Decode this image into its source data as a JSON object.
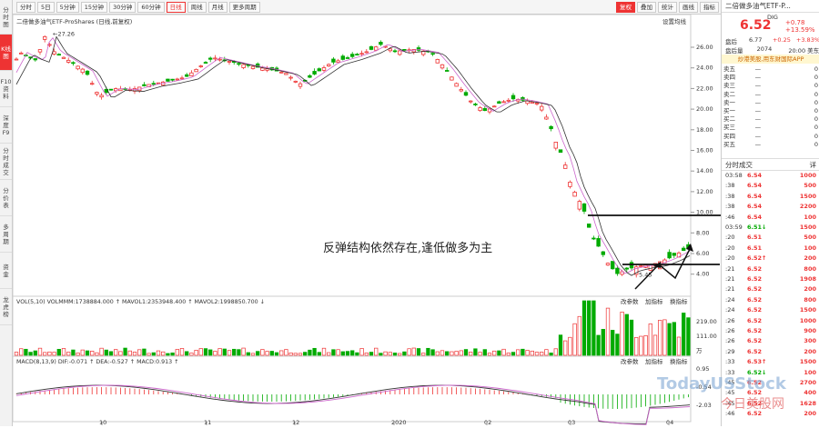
{
  "sidebar": [
    "分时图",
    "K线图",
    "F10资料",
    "深度F9",
    "分时成交",
    "分价表",
    "多周期",
    "资金",
    "龙虎榜"
  ],
  "toolbar": {
    "items": [
      "分时",
      "5日",
      "5分钟",
      "15分钟",
      "30分钟",
      "60分钟",
      "日线",
      "周线",
      "月线",
      "更多周期"
    ],
    "active": "日线",
    "right": [
      "复权",
      "叠加",
      "统计",
      "画线",
      "指标"
    ]
  },
  "chart": {
    "title": "二倍做多油气ETF-ProShares (日线,前复权)",
    "settings": "设置均线",
    "high_label": "27.26",
    "low_label": "5.45",
    "price_ticks": [
      "26.00",
      "24.00",
      "22.00",
      "20.00",
      "18.00",
      "16.00",
      "14.00",
      "12.00",
      "10.00",
      "8.00",
      "6.00",
      "4.00"
    ],
    "vol_legend": "VOL(5,10) VOLMMM:1738884.000 ↑ MAVOL1:2353948.400 ↑ MAVOL2:1998850.700 ↓",
    "vol_ticks": [
      "219.00",
      "111.00",
      "万"
    ],
    "macd_legend": "MACD(8,13,9) DIF:-0.071 ↑ DEA:-0.527 ↑ MACD:0.913 ↑",
    "macd_ticks": [
      "0.95",
      "-0.54",
      "-2.03"
    ],
    "sub_buttons": [
      "改参数",
      "加指标",
      "换指标"
    ],
    "dates": [
      "10",
      "11",
      "12",
      "2020",
      "02",
      "03",
      "04"
    ],
    "annotation": "反弹结构依然存在,逢低做多为主"
  },
  "quote": {
    "name": "二倍做多油气ETF-P...",
    "code": "DIG",
    "price": "6.52",
    "change": "+0.78",
    "pct": "+13.59%",
    "row1": [
      "盘后",
      "6.77",
      "+0.25",
      "+3.83%"
    ],
    "row2": [
      "盘后量",
      "2074",
      "20:00 美东"
    ],
    "banner": "炒港美股,用东财国际APP",
    "asks": [
      [
        "卖五",
        "—",
        "0"
      ],
      [
        "卖四",
        "—",
        "0"
      ],
      [
        "卖三",
        "—",
        "0"
      ],
      [
        "卖二",
        "—",
        "0"
      ],
      [
        "卖一",
        "—",
        "0"
      ]
    ],
    "bids": [
      [
        "买一",
        "—",
        "0"
      ],
      [
        "买二",
        "—",
        "0"
      ],
      [
        "买三",
        "—",
        "0"
      ],
      [
        "买四",
        "—",
        "0"
      ],
      [
        "买五",
        "—",
        "0"
      ]
    ],
    "ticks_header": [
      "分时成交",
      "详"
    ],
    "ticks": [
      [
        "03:58",
        "6.54",
        "1000"
      ],
      [
        ":38",
        "6.54",
        "500"
      ],
      [
        ":38",
        "6.54",
        "1500"
      ],
      [
        ":38",
        "6.54",
        "2200"
      ],
      [
        ":46",
        "6.54",
        "100"
      ],
      [
        "03:59",
        "6.51↓",
        "1500"
      ],
      [
        ":20",
        "6.51",
        "500"
      ],
      [
        ":20",
        "6.51",
        "100"
      ],
      [
        ":20",
        "6.52↑",
        "200"
      ],
      [
        ":21",
        "6.52",
        "800"
      ],
      [
        ":21",
        "6.52",
        "1908"
      ],
      [
        ":21",
        "6.52",
        "200"
      ],
      [
        ":24",
        "6.52",
        "800"
      ],
      [
        ":24",
        "6.52",
        "1500"
      ],
      [
        ":26",
        "6.52",
        "1000"
      ],
      [
        ":26",
        "6.52",
        "900"
      ],
      [
        ":26",
        "6.52",
        "300"
      ],
      [
        ":29",
        "6.52",
        "200"
      ],
      [
        ":33",
        "6.53↑",
        "1500"
      ],
      [
        ":33",
        "6.52↓",
        "100"
      ],
      [
        ":45",
        "6.52",
        "2700"
      ],
      [
        ":45",
        "6.52",
        "400"
      ],
      [
        ":45",
        "6.52",
        "1628"
      ],
      [
        ":46",
        "6.52",
        "200"
      ]
    ]
  },
  "watermark": "TodayUSStock",
  "watermark2": "今日美股网",
  "colors": {
    "up": "#e33",
    "down": "#0a0"
  }
}
